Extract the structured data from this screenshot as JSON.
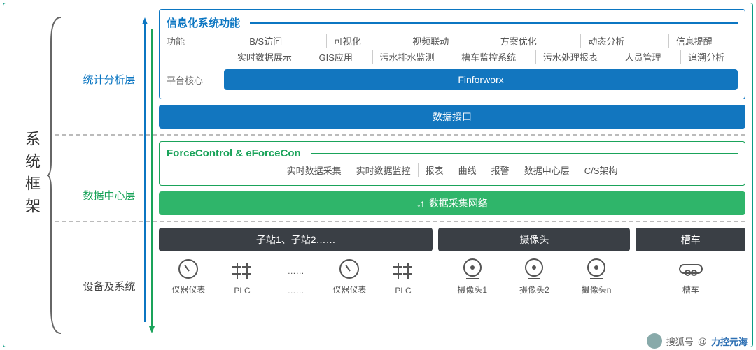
{
  "title": "系统框架",
  "layers": {
    "stats": "统计分析层",
    "center": "数据中心层",
    "device": "设备及系统"
  },
  "info_card": {
    "head": "信息化系统功能",
    "row1_label": "功能",
    "row1": [
      "B/S访问",
      "可视化",
      "视频联动",
      "方案优化",
      "动态分析",
      "信息提醒"
    ],
    "row2": [
      "实时数据展示",
      "GIS应用",
      "污水排水监测",
      "槽车监控系统",
      "污水处理报表",
      "人员管理",
      "追溯分析"
    ],
    "core_label": "平台核心",
    "core": "Finforworx"
  },
  "data_interface": "数据接口",
  "force_card": {
    "head": "ForceControl & eForceCon",
    "row": [
      "实时数据采集",
      "实时数据监控",
      "报表",
      "曲线",
      "报警",
      "数据中心层",
      "C/S架构"
    ]
  },
  "collect_net": "数据采集网络",
  "device_groups": {
    "g1": {
      "title": "子站1、子站2……",
      "items": [
        {
          "icon": "gauge",
          "label": "仪器仪表"
        },
        {
          "icon": "plc",
          "label": "PLC"
        },
        {
          "icon": "dots",
          "label": "……"
        },
        {
          "icon": "gauge",
          "label": "仪器仪表"
        },
        {
          "icon": "plc",
          "label": "PLC"
        }
      ]
    },
    "g2": {
      "title": "摄像头",
      "items": [
        {
          "icon": "cam",
          "label": "摄像头1"
        },
        {
          "icon": "cam",
          "label": "摄像头2"
        },
        {
          "icon": "cam",
          "label": "摄像头n"
        }
      ]
    },
    "g3": {
      "title": "槽车",
      "items": [
        {
          "icon": "tank",
          "label": "槽车"
        }
      ]
    }
  },
  "credit": {
    "prefix": "搜狐号",
    "name": "力控元海"
  }
}
